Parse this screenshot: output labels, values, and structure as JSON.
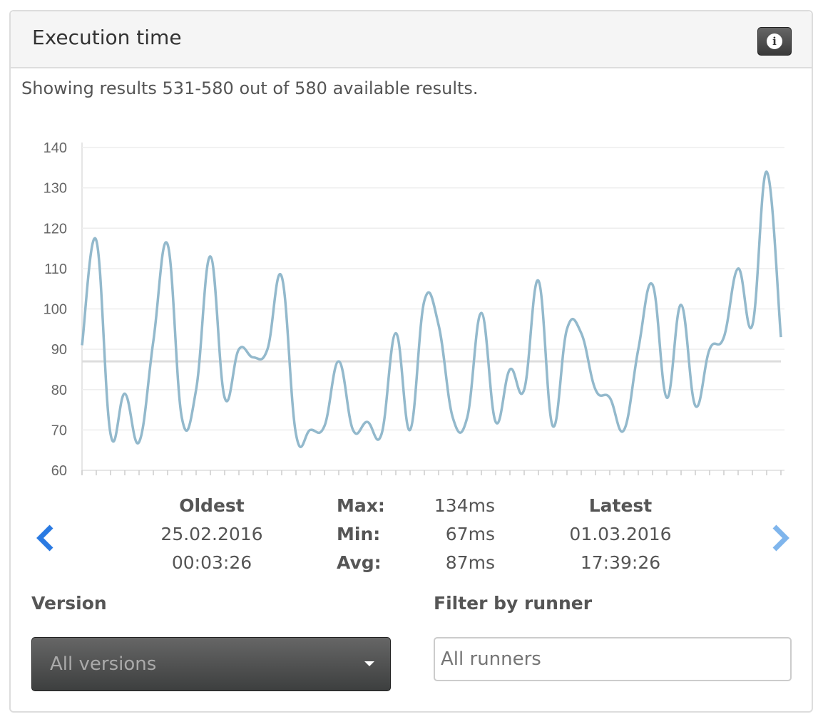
{
  "header": {
    "title": "Execution time",
    "info_icon": "info-icon"
  },
  "showing": "Showing results 531-580 out of 580 available results.",
  "chart_data": {
    "type": "line",
    "title": "",
    "xlabel": "",
    "ylabel": "",
    "ylim": [
      60,
      140
    ],
    "yticks": [
      "60",
      "70",
      "80",
      "90",
      "100",
      "110",
      "120",
      "130",
      "140"
    ],
    "series": [
      {
        "name": "Execution time (ms)",
        "color": "#93b9cc",
        "values": [
          91,
          117,
          69,
          79,
          67,
          92,
          116,
          73,
          80,
          113,
          78,
          90,
          88,
          90,
          108,
          69,
          70,
          71,
          87,
          70,
          72,
          69,
          94,
          70,
          102,
          96,
          73,
          73,
          99,
          72,
          85,
          80,
          107,
          71,
          95,
          94,
          80,
          78,
          70,
          90,
          106,
          78,
          101,
          76,
          90,
          93,
          110,
          96,
          134,
          93
        ]
      }
    ],
    "average": {
      "value": 87,
      "color": "#dddddd"
    },
    "grid": true
  },
  "stats": {
    "oldest_label": "Oldest",
    "oldest_date": "25.02.2016",
    "oldest_time": "00:03:26",
    "max_label": "Max:",
    "max": "134ms",
    "min_label": "Min:",
    "min": "67ms",
    "avg_label": "Avg:",
    "avg": "87ms",
    "latest_label": "Latest",
    "latest_date": "01.03.2016",
    "latest_time": "17:39:26",
    "prev": "‹",
    "next": "›"
  },
  "version": {
    "label": "Version",
    "selected": "All versions"
  },
  "runner": {
    "label": "Filter by runner",
    "placeholder": "All runners"
  }
}
